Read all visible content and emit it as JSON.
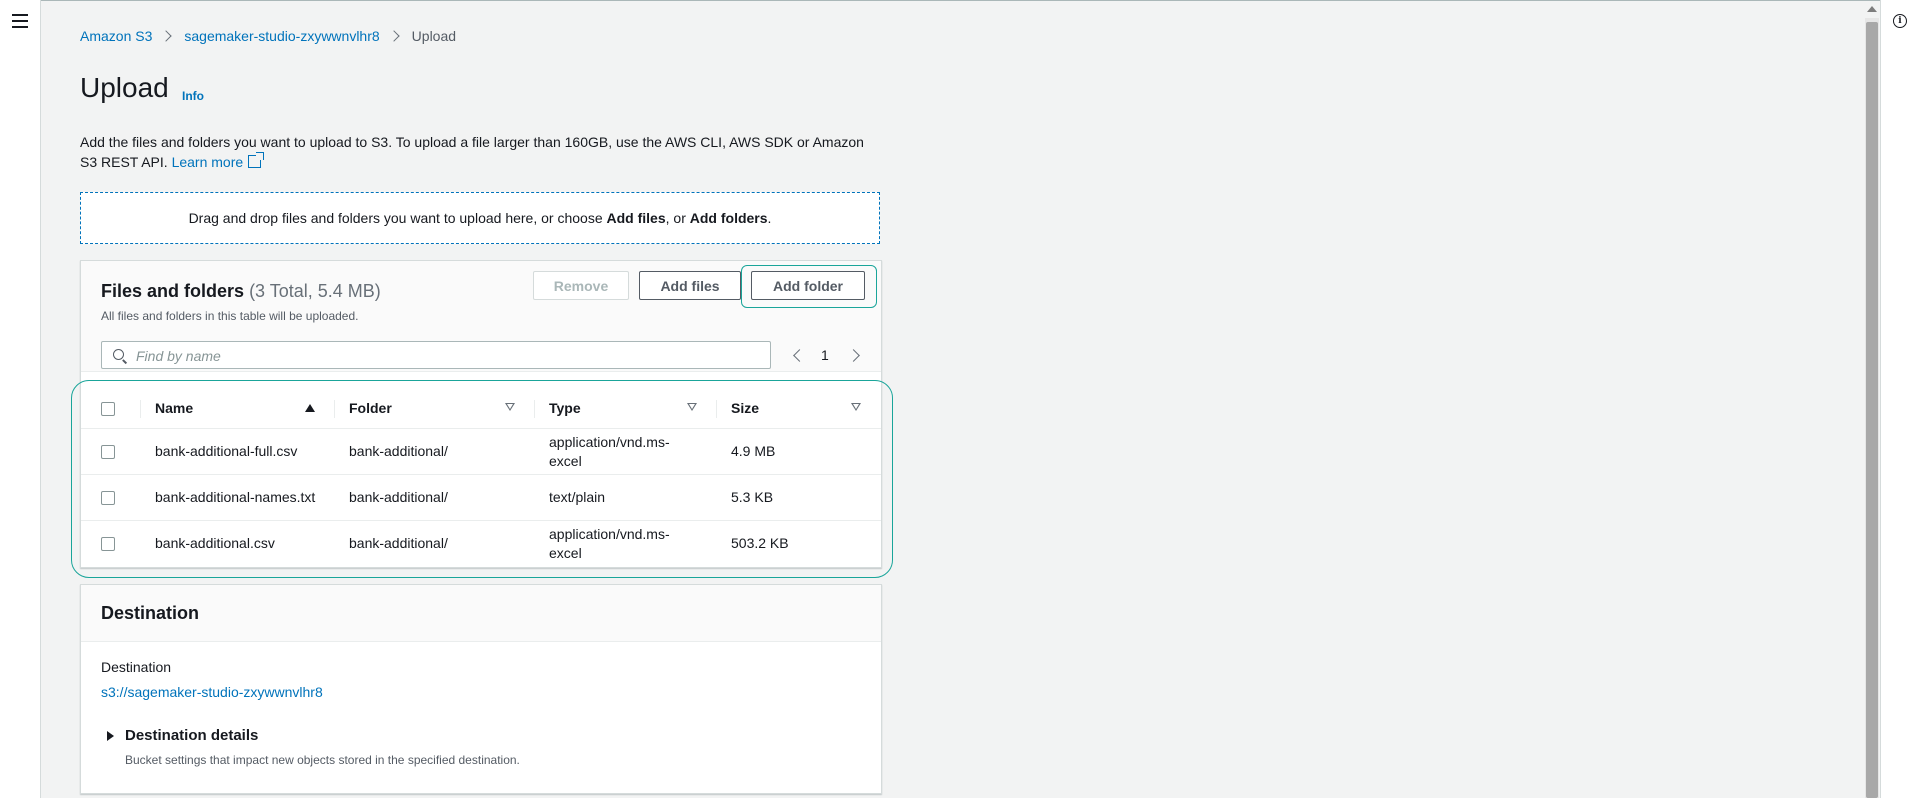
{
  "breadcrumb": {
    "root": "Amazon S3",
    "bucket": "sagemaker-studio-zxywwnvlhr8",
    "current": "Upload"
  },
  "page": {
    "title": "Upload",
    "info": "Info",
    "description": "Add the files and folders you want to upload to S3. To upload a file larger than 160GB, use the AWS CLI, AWS SDK or Amazon S3 REST API.",
    "learn_more": "Learn more"
  },
  "dropzone": {
    "text_before": "Drag and drop files and folders you want to upload here, or choose ",
    "add_files": "Add files",
    "text_middle": ", or ",
    "add_folders": "Add folders",
    "text_after": "."
  },
  "files_panel": {
    "title": "Files and folders",
    "count": "(3 Total, 5.4 MB)",
    "subtitle": "All files and folders in this table will be uploaded.",
    "remove_label": "Remove",
    "add_files_label": "Add files",
    "add_folder_label": "Add folder",
    "search_placeholder": "Find by name",
    "page_number": "1",
    "columns": {
      "name": "Name",
      "folder": "Folder",
      "type": "Type",
      "size": "Size"
    },
    "rows": [
      {
        "name": "bank-additional-full.csv",
        "folder": "bank-additional/",
        "type": "application/vnd.ms-excel",
        "size": "4.9 MB"
      },
      {
        "name": "bank-additional-names.txt",
        "folder": "bank-additional/",
        "type": "text/plain",
        "size": "5.3 KB"
      },
      {
        "name": "bank-additional.csv",
        "folder": "bank-additional/",
        "type": "application/vnd.ms-excel",
        "size": "503.2 KB"
      }
    ]
  },
  "destination": {
    "title": "Destination",
    "label": "Destination",
    "uri": "s3://sagemaker-studio-zxywwnvlhr8",
    "details_title": "Destination details",
    "details_desc": "Bucket settings that impact new objects stored in the specified destination."
  },
  "icons": {
    "menu": "hamburger-menu-icon",
    "help": "info-circle-icon",
    "search": "search-icon",
    "external": "external-link-icon"
  },
  "colors": {
    "link": "#0073bb",
    "focus": "#1aa59a",
    "background": "#f2f3f3"
  }
}
